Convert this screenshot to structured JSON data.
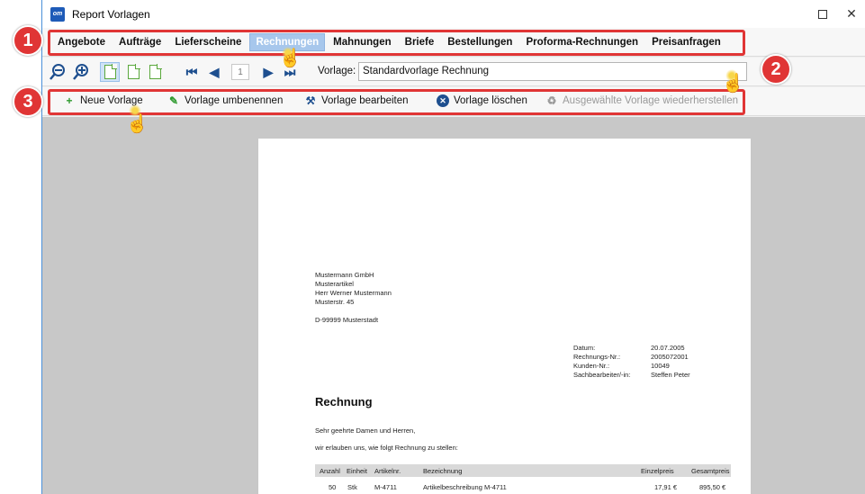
{
  "window": {
    "title": "Report Vorlagen",
    "logo_text": "om",
    "controls": {
      "maximize": "",
      "close": "✕"
    }
  },
  "tabs": [
    "Angebote",
    "Aufträge",
    "Lieferscheine",
    "Rechnungen",
    "Mahnungen",
    "Briefe",
    "Bestellungen",
    "Proforma-Rechnungen",
    "Preisanfragen"
  ],
  "active_tab": "Rechnungen",
  "toolbar": {
    "page_number": "1",
    "vorlage_label": "Vorlage:",
    "vorlage_value": "Standardvorlage Rechnung",
    "nav": {
      "first": "⏮",
      "prev": "◀",
      "next": "▶",
      "last": "⏭"
    }
  },
  "actions": {
    "new": "Neue Vorlage",
    "rename": "Vorlage umbenennen",
    "edit": "Vorlage bearbeiten",
    "delete": "Vorlage löschen",
    "restore": "Ausgewählte Vorlage wiederherstellen"
  },
  "document": {
    "address": [
      "Mustermann GmbH",
      "Musterartikel",
      "Herr Werner Mustermann",
      "Musterstr. 45"
    ],
    "city": "D-99999 Musterstadt",
    "info_labels": [
      "Datum:",
      "Rechnungs-Nr.:",
      "Kunden-Nr.:",
      "Sachbearbeiter/-in:"
    ],
    "info_values": [
      "20.07.2005",
      "2005072001",
      "10049",
      "Steffen Peter"
    ],
    "heading": "Rechnung",
    "salutation": "Sehr geehrte Damen und Herren,",
    "intro": "wir erlauben uns, wie folgt Rechnung zu stellen:",
    "table_headers": [
      "Anzahl",
      "Einheit",
      "Artikelnr.",
      "Bezeichnung",
      "Einzelpreis",
      "Gesamtpreis"
    ],
    "row": [
      "50",
      "Stk",
      "M-4711",
      "Artikelbeschreibung M-4711",
      "17,91 €",
      "895,50 €"
    ]
  },
  "callouts": [
    "1",
    "2",
    "3"
  ],
  "colors": {
    "accent": "#e03535",
    "tab_active": "#a7c7ec",
    "page_icon": "#5aa83c"
  }
}
